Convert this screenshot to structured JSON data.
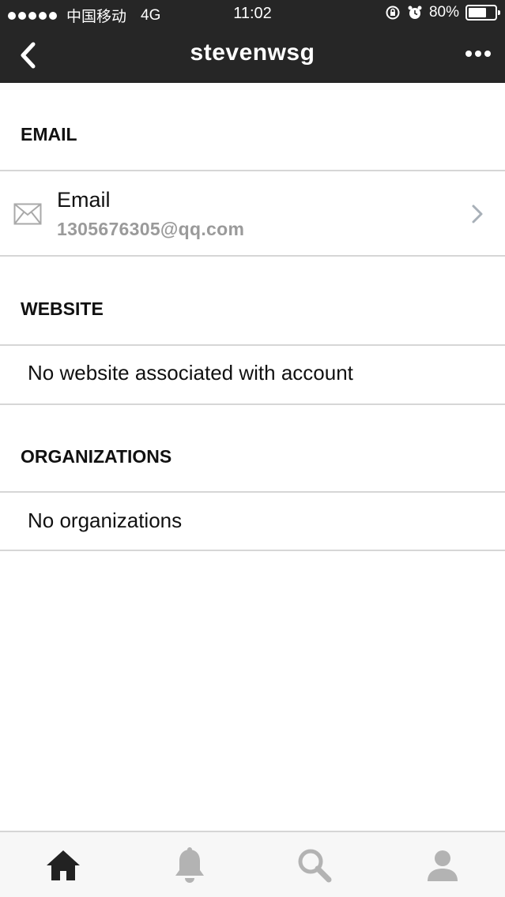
{
  "status_bar": {
    "carrier": "中国移动",
    "network": "4G",
    "time": "11:02",
    "battery_percent": "80%",
    "battery_level": 0.8,
    "icons": [
      "signal-dots",
      "rotation-lock-icon",
      "alarm-icon",
      "battery-icon"
    ]
  },
  "nav": {
    "title": "stevenwsg",
    "back_icon": "chevron-left-icon",
    "more_icon": "more-dots-icon"
  },
  "sections": {
    "email": {
      "header": "EMAIL",
      "row_label": "Email",
      "row_value": "1305676305@qq.com",
      "icon": "envelope-icon"
    },
    "website": {
      "header": "WEBSITE",
      "empty_text": "No website associated with account"
    },
    "organizations": {
      "header": "ORGANIZATIONS",
      "empty_text": "No organizations"
    }
  },
  "tabbar": {
    "items": [
      {
        "name": "home",
        "icon": "home-icon",
        "active": true
      },
      {
        "name": "notifications",
        "icon": "bell-icon",
        "active": false
      },
      {
        "name": "search",
        "icon": "search-icon",
        "active": false
      },
      {
        "name": "profile",
        "icon": "person-icon",
        "active": false
      }
    ]
  },
  "colors": {
    "topbar": "#262626",
    "divider": "#d6d6d6",
    "secondary_text": "#9a9a9a",
    "tab_active": "#222222",
    "tab_inactive": "#b3b3b3",
    "tabbar_bg": "#f7f7f7"
  }
}
